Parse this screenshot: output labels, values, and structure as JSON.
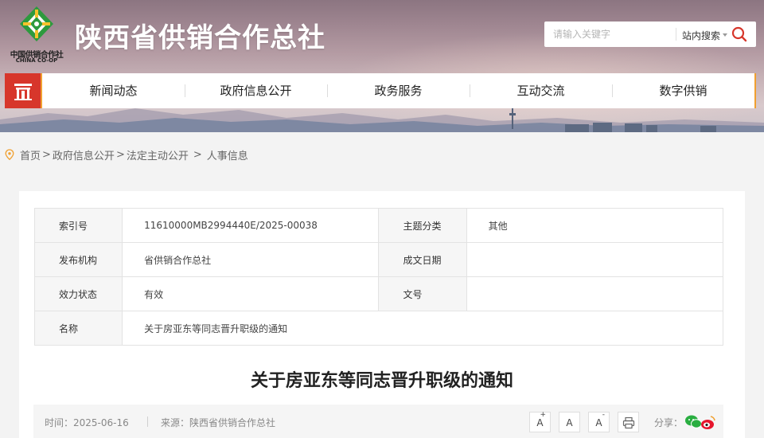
{
  "header": {
    "site_title": "陕西省供销合作总社",
    "logo_cn": "中国供销合作社",
    "logo_en": "CHINA CO-OP",
    "search": {
      "placeholder": "请输入关键字",
      "scope_label": "站内搜索",
      "search_icon": "search-icon"
    }
  },
  "nav": {
    "home_icon": "gate-icon",
    "items": [
      "新闻动态",
      "政府信息公开",
      "政务服务",
      "互动交流",
      "数字供销"
    ]
  },
  "breadcrumb": {
    "icon": "location-pin-icon",
    "items": [
      "首页",
      "政府信息公开",
      "法定主动公开"
    ],
    "separator": ">",
    "current": "人事信息"
  },
  "meta_table": {
    "index_label": "索引号",
    "index_value": "11610000MB2994440E/2025-00038",
    "category_label": "主题分类",
    "category_value": "其他",
    "publisher_label": "发布机构",
    "publisher_value": "省供销合作总社",
    "date_label": "成文日期",
    "date_value": "",
    "status_label": "效力状态",
    "status_value": "有效",
    "doc_no_label": "文号",
    "doc_no_value": "",
    "name_label": "名称",
    "name_value": "关于房亚东等同志晋升职级的通知"
  },
  "article": {
    "title": "关于房亚东等同志晋升职级的通知",
    "time_text": "时间：2025-06-16",
    "source_text": "来源：陕西省供销合作总社",
    "font_increase_label": "A",
    "font_increase_mark": "+",
    "font_normal_label": "A",
    "font_decrease_label": "A",
    "font_decrease_mark": "-",
    "print_icon": "print-icon",
    "share_label": "分享：",
    "share_icons": [
      "wechat-icon",
      "weibo-icon"
    ]
  },
  "colors": {
    "nav_home_bg": "#d7362b",
    "nav_accent": "#f0a030",
    "logo_green": "#2d9a3e",
    "search_icon": "#d7362b"
  }
}
